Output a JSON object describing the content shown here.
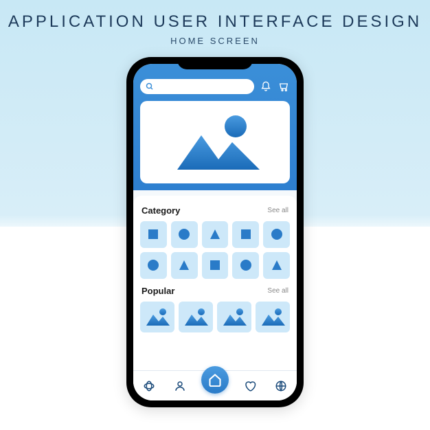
{
  "page": {
    "title": "APPLICATION USER INTERFACE DESIGN",
    "subtitle": "HOME SCREEN"
  },
  "sections": {
    "category": {
      "title": "Category",
      "see_all": "See all"
    },
    "popular": {
      "title": "Popular",
      "see_all": "See all"
    }
  },
  "category_shapes": [
    "square",
    "circle",
    "triangle",
    "square",
    "circle",
    "circle",
    "triangle",
    "square",
    "circle",
    "triangle"
  ],
  "nav": {
    "items": [
      "loop",
      "profile",
      "home",
      "heart",
      "globe"
    ]
  }
}
